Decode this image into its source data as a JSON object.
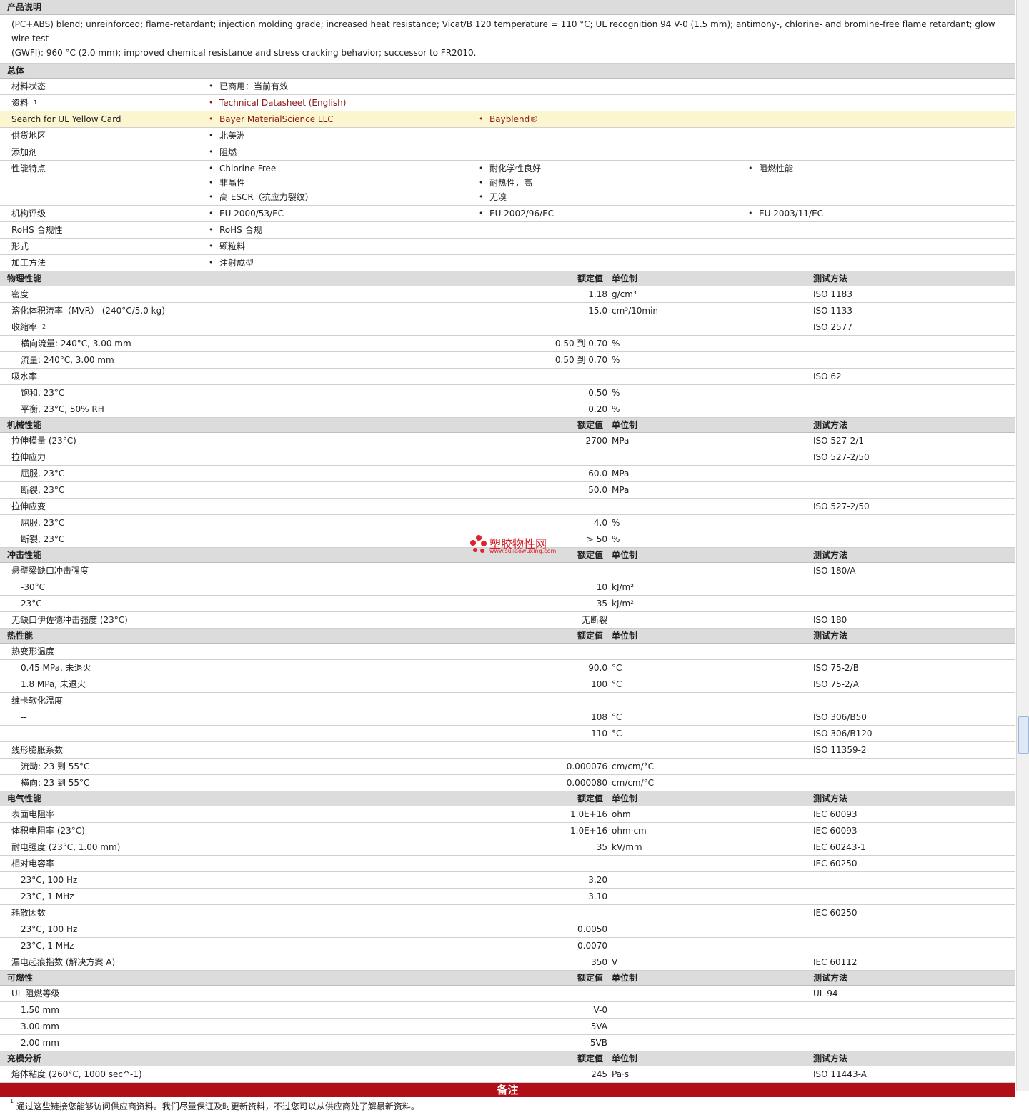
{
  "desc_title": "产品说明",
  "desc_line1": "(PC+ABS) blend; unreinforced; flame-retardant; injection molding grade; increased heat resistance; Vicat/B 120 temperature = 110 °C; UL recognition 94 V-0 (1.5 mm); antimony-, chlorine- and bromine-free flame retardant; glow wire test",
  "desc_line2": "(GWFI): 960 °C (2.0 mm); improved chemical resistance and stress cracking behavior; successor to FR2010.",
  "general_title": "总体",
  "general": [
    {
      "label": "材料状态",
      "items": [
        [
          "已商用：当前有效"
        ]
      ]
    },
    {
      "label": "资料",
      "sup": "1",
      "link": true,
      "items": [
        [
          "Technical Datasheet (English)"
        ]
      ]
    },
    {
      "label": "Search for UL Yellow Card",
      "link": true,
      "highlight": true,
      "items": [
        [
          "Bayer MaterialScience LLC"
        ],
        [
          "Bayblend®"
        ]
      ]
    },
    {
      "label": "供货地区",
      "items": [
        [
          "北美洲"
        ]
      ]
    },
    {
      "label": "添加剂",
      "items": [
        [
          "阻燃"
        ]
      ]
    },
    {
      "label": "性能特点",
      "items": [
        [
          "Chlorine Free",
          "非晶性",
          "高 ESCR（抗应力裂纹）"
        ],
        [
          "耐化学性良好",
          "耐热性，高",
          "无溴"
        ],
        [
          "阻燃性能"
        ]
      ]
    },
    {
      "label": "机构评级",
      "items": [
        [
          "EU 2000/53/EC"
        ],
        [
          "EU 2002/96/EC"
        ],
        [
          "EU 2003/11/EC"
        ]
      ]
    },
    {
      "label": "RoHS 合规性",
      "items": [
        [
          "RoHS 合规"
        ]
      ]
    },
    {
      "label": "形式",
      "items": [
        [
          "颗粒料"
        ]
      ]
    },
    {
      "label": "加工方法",
      "items": [
        [
          "注射成型"
        ]
      ]
    }
  ],
  "col_value": "额定值",
  "col_unit": "单位制",
  "col_method": "测试方法",
  "sections": [
    {
      "title": "物理性能",
      "rows": [
        {
          "label": "密度",
          "value": "1.18",
          "unit": "g/cm³",
          "method": "ISO 1183"
        },
        {
          "label": "溶化体积流率（MVR） (240°C/5.0 kg)",
          "value": "15.0",
          "unit": "cm³/10min",
          "method": "ISO 1133"
        },
        {
          "label": "收缩率",
          "sup": "2",
          "method": "ISO 2577"
        },
        {
          "label": "横向流量: 240°C, 3.00 mm",
          "sub": true,
          "value": "0.50 到  0.70",
          "unit": "%"
        },
        {
          "label": "流量: 240°C, 3.00 mm",
          "sub": true,
          "value": "0.50 到  0.70",
          "unit": "%"
        },
        {
          "label": "吸水率",
          "method": "ISO 62"
        },
        {
          "label": "饱和, 23°C",
          "sub": true,
          "value": "0.50",
          "unit": "%"
        },
        {
          "label": "平衡, 23°C, 50% RH",
          "sub": true,
          "value": "0.20",
          "unit": "%"
        }
      ]
    },
    {
      "title": "机械性能",
      "rows": [
        {
          "label": "拉伸模量 (23°C)",
          "value": "2700",
          "unit": "MPa",
          "method": "ISO 527-2/1"
        },
        {
          "label": "拉伸应力",
          "method": "ISO 527-2/50"
        },
        {
          "label": "屈服, 23°C",
          "sub": true,
          "value": "60.0",
          "unit": "MPa"
        },
        {
          "label": "断裂, 23°C",
          "sub": true,
          "value": "50.0",
          "unit": "MPa"
        },
        {
          "label": "拉伸应变",
          "method": "ISO 527-2/50"
        },
        {
          "label": "屈服, 23°C",
          "sub": true,
          "value": "4.0",
          "unit": "%"
        },
        {
          "label": "断裂, 23°C",
          "sub": true,
          "value": "> 50",
          "unit": "%"
        }
      ]
    },
    {
      "title": "冲击性能",
      "rows": [
        {
          "label": "悬壁梁缺口冲击强度",
          "method": "ISO 180/A"
        },
        {
          "label": "-30°C",
          "sub": true,
          "value": "10",
          "unit": "kJ/m²"
        },
        {
          "label": "23°C",
          "sub": true,
          "value": "35",
          "unit": "kJ/m²"
        },
        {
          "label": "无缺口伊佐德冲击强度 (23°C)",
          "value": "无断裂",
          "method": "ISO 180"
        }
      ]
    },
    {
      "title": "热性能",
      "rows": [
        {
          "label": "热变形温度"
        },
        {
          "label": "0.45 MPa, 未退火",
          "sub": true,
          "value": "90.0",
          "unit": "°C",
          "method": "ISO 75-2/B"
        },
        {
          "label": "1.8 MPa, 未退火",
          "sub": true,
          "value": "100",
          "unit": "°C",
          "method": "ISO 75-2/A"
        },
        {
          "label": "维卡软化温度"
        },
        {
          "label": "--",
          "sub": true,
          "value": "108",
          "unit": "°C",
          "method": "ISO 306/B50"
        },
        {
          "label": "--",
          "sub": true,
          "value": "110",
          "unit": "°C",
          "method": "ISO 306/B120"
        },
        {
          "label": "线形膨胀系数",
          "method": "ISO 11359-2"
        },
        {
          "label": "流动: 23 到  55°C",
          "sub": true,
          "value": "0.000076",
          "unit": "cm/cm/°C"
        },
        {
          "label": "横向: 23 到  55°C",
          "sub": true,
          "value": "0.000080",
          "unit": "cm/cm/°C"
        }
      ]
    },
    {
      "title": "电气性能",
      "rows": [
        {
          "label": "表面电阻率",
          "value": "1.0E+16",
          "unit": "ohm",
          "method": "IEC 60093"
        },
        {
          "label": "体积电阻率 (23°C)",
          "value": "1.0E+16",
          "unit": "ohm·cm",
          "method": "IEC 60093"
        },
        {
          "label": "耐电强度 (23°C, 1.00 mm)",
          "value": "35",
          "unit": "kV/mm",
          "method": "IEC 60243-1"
        },
        {
          "label": "相对电容率",
          "method": "IEC 60250"
        },
        {
          "label": "23°C, 100 Hz",
          "sub": true,
          "value": "3.20"
        },
        {
          "label": "23°C, 1 MHz",
          "sub": true,
          "value": "3.10"
        },
        {
          "label": "耗散因数",
          "method": "IEC 60250"
        },
        {
          "label": "23°C, 100 Hz",
          "sub": true,
          "value": "0.0050"
        },
        {
          "label": "23°C, 1 MHz",
          "sub": true,
          "value": "0.0070"
        },
        {
          "label": "漏电起痕指数 (解决方案 A)",
          "value": "350",
          "unit": "V",
          "method": "IEC 60112"
        }
      ]
    },
    {
      "title": "可燃性",
      "rows": [
        {
          "label": "UL 阻燃等级",
          "method": "UL 94"
        },
        {
          "label": "1.50 mm",
          "sub": true,
          "value": "V-0"
        },
        {
          "label": "3.00 mm",
          "sub": true,
          "value": "5VA"
        },
        {
          "label": "2.00 mm",
          "sub": true,
          "value": "5VB"
        }
      ]
    },
    {
      "title": "充模分析",
      "rows": [
        {
          "label": "熔体粘度 (260°C, 1000 sec^-1)",
          "value": "245",
          "unit": "Pa·s",
          "method": "ISO 11443-A"
        }
      ]
    }
  ],
  "notes_title": "备注",
  "footnote_num": "1",
  "footnote": "通过这些链接您能够访问供应商资料。我们尽量保证及时更新资料，不过您可以从供应商处了解最新资料。",
  "watermark": {
    "title": "塑胶物性网",
    "url": "www.sujiaowuxing.com",
    "dot_color": "#e0222b"
  }
}
